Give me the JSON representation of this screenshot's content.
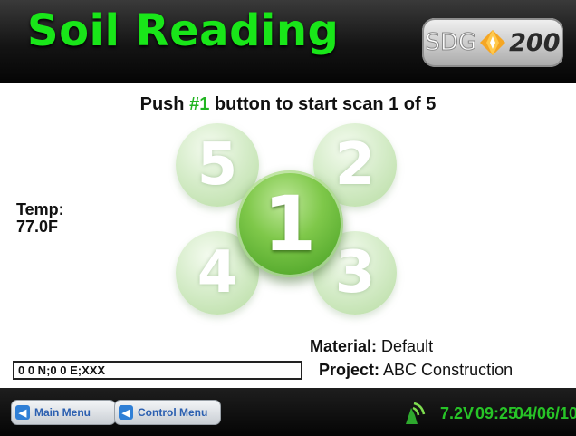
{
  "header": {
    "title": "Soil Reading",
    "logo_text": "SDG",
    "logo_number": "200"
  },
  "instruction": {
    "prefix": "Push ",
    "highlight": "#1",
    "suffix": " button to start scan 1 of 5"
  },
  "temp": {
    "label": "Temp:",
    "value": "77.0F"
  },
  "scan_buttons": [
    {
      "label": "5",
      "state": "inactive"
    },
    {
      "label": "2",
      "state": "inactive"
    },
    {
      "label": "1",
      "state": "active"
    },
    {
      "label": "4",
      "state": "inactive"
    },
    {
      "label": "3",
      "state": "inactive"
    }
  ],
  "material": {
    "label": "Material:",
    "value": "Default"
  },
  "project": {
    "label": "Project:",
    "value": "ABC Construction"
  },
  "gps": {
    "value": "0 0 N;0 0 E;XXX"
  },
  "footer": {
    "main_menu": "Main Menu",
    "control_menu": "Control Menu",
    "signal_icon": "wireless-signal-icon",
    "voltage": "7.2V",
    "time": "09:25",
    "date": "04/06/10"
  },
  "colors": {
    "accent_green": "#19e619",
    "status_green": "#27c427",
    "highlight_green": "#22b522",
    "menu_blue": "#2b5fb0"
  }
}
